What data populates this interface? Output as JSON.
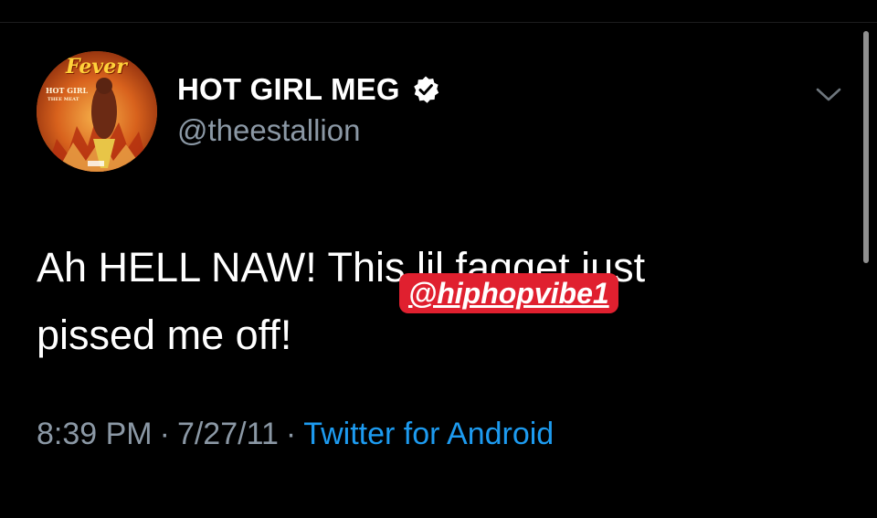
{
  "tweet": {
    "display_name": "HOT GIRL MEG",
    "handle": "@theestallion",
    "text_lines": [
      "Ah HELL NAW! This lil fagget just",
      "pissed me off!"
    ],
    "time": "8:39 PM",
    "date": "7/27/11",
    "separator": "·",
    "source": "Twitter for Android"
  },
  "avatar": {
    "album_title": "Fever",
    "artist": "HOT GIRL",
    "artist_sub": "THEE MEAT"
  },
  "overlay": {
    "watermark": "@hiphopvibe1"
  },
  "icons": {
    "verified": "verified-badge-icon",
    "menu": "chevron-down-icon"
  },
  "colors": {
    "background": "#000000",
    "text_primary": "#ffffff",
    "text_secondary": "#8b98a5",
    "link": "#1d9bf0",
    "watermark_bg": "#e0202f"
  }
}
